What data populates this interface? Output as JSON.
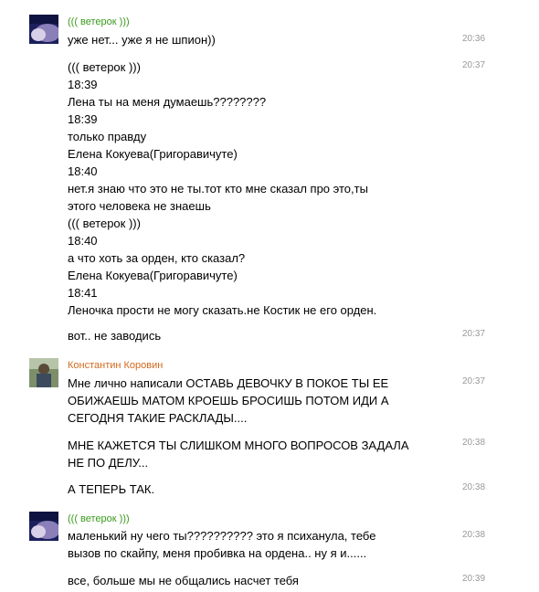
{
  "colors": {
    "author_green": "#3a9a1c",
    "author_orange": "#d2691e",
    "text": "#000000",
    "time": "#999999"
  },
  "chat": {
    "group1": {
      "author": "((( ветерок )))",
      "messages": [
        {
          "lines": [
            "уже нет... уже я не шпион))"
          ],
          "time": "20:36"
        },
        {
          "lines": [
            "((( ветерок )))",
            "18:39",
            "Лена ты на меня думаешь????????",
            "18:39",
            "только правду",
            "Елена Кокуева(Григоравичуте)",
            "18:40",
            "нет.я знаю что это не ты.тот кто мне сказал про это,ты",
            "этого человека не знаешь",
            "((( ветерок )))",
            "18:40",
            "а что хоть за орден, кто сказал?",
            "Елена Кокуева(Григоравичуте)",
            "18:41",
            "Леночка прости не могу сказать.не Костик не его орден."
          ],
          "time": "20:37"
        },
        {
          "lines": [
            "вот.. не заводись"
          ],
          "time": "20:37"
        }
      ]
    },
    "group2": {
      "author": "Константин Коровин",
      "messages": [
        {
          "lines": [
            "Мне лично написали ОСТАВЬ ДЕВОЧКУ В ПОКОЕ ТЫ ЕЕ",
            "ОБИЖАЕШЬ МАТОМ КРОЕШЬ БРОСИШЬ ПОТОМ ИДИ А",
            "СЕГОДНЯ ТАКИЕ РАСКЛАДЫ...."
          ],
          "time": "20:37"
        },
        {
          "lines": [
            "МНЕ КАЖЕТСЯ ТЫ СЛИШКОМ МНОГО ВОПРОСОВ ЗАДАЛА",
            "НЕ ПО ДЕЛУ..."
          ],
          "time": "20:38"
        },
        {
          "lines": [
            "А ТЕПЕРЬ ТАК."
          ],
          "time": "20:38"
        }
      ]
    },
    "group3": {
      "author": "((( ветерок )))",
      "messages": [
        {
          "lines": [
            "маленький ну чего ты?????????? это я психанула, тебе",
            "вызов по скайпу, меня пробивка на ордена.. ну я и......"
          ],
          "time": "20:38"
        },
        {
          "lines": [
            "все, больше мы не общались насчет тебя"
          ],
          "time": "20:39"
        }
      ]
    }
  }
}
